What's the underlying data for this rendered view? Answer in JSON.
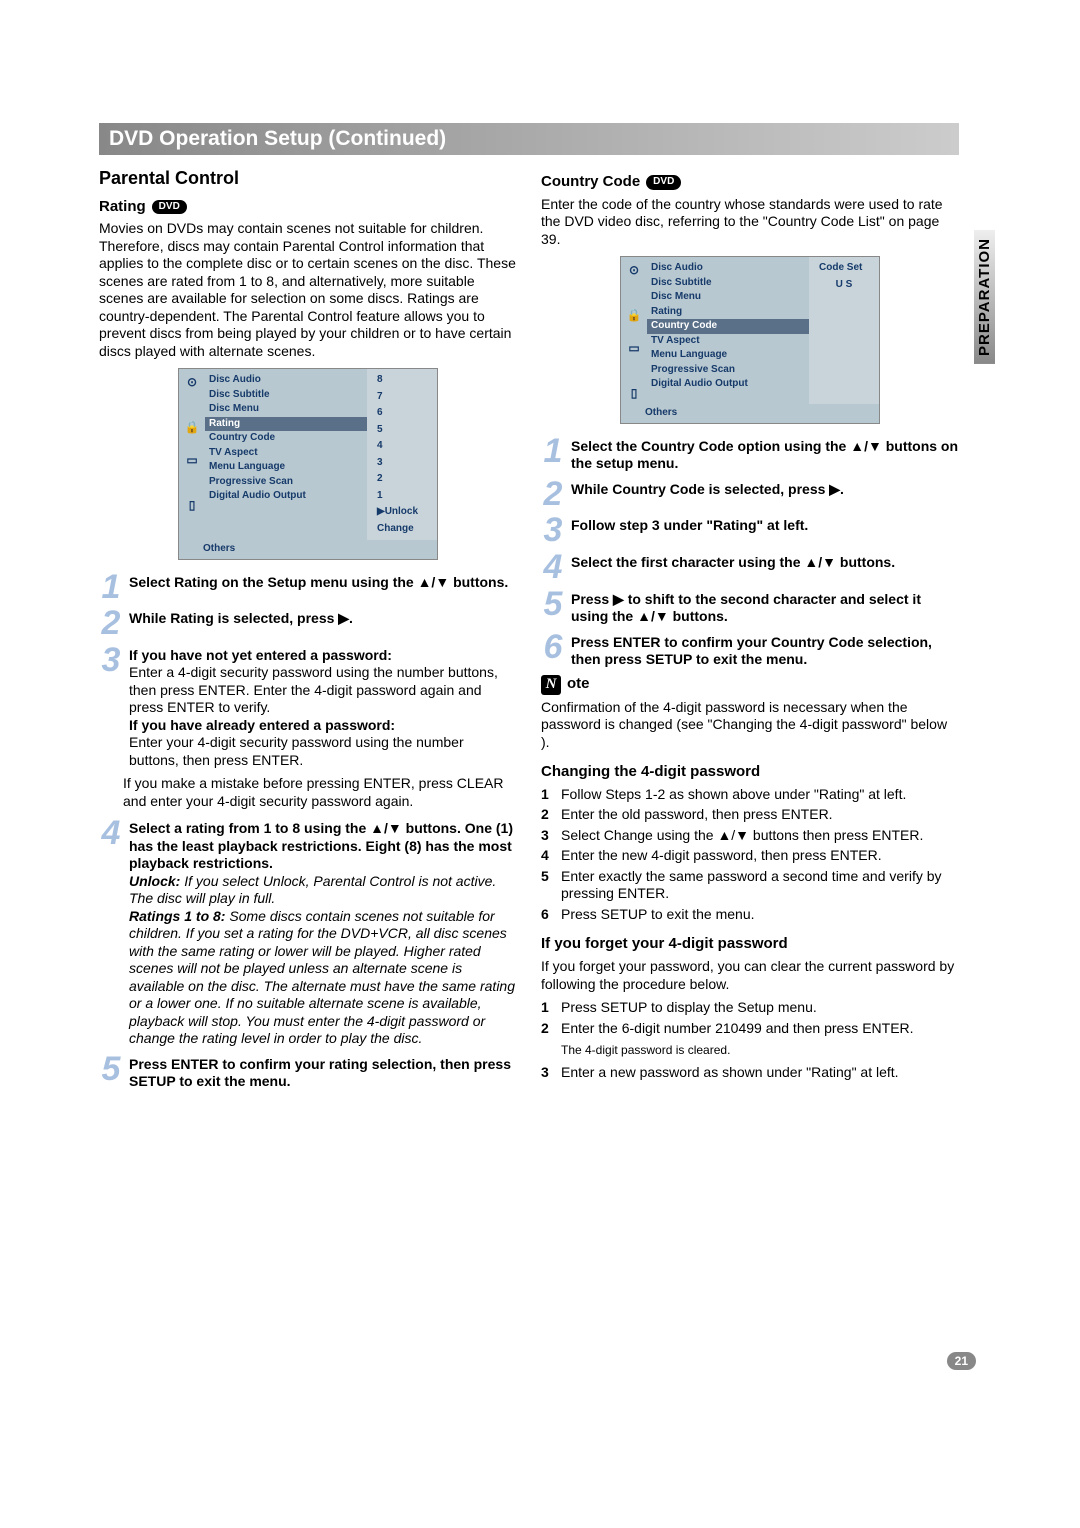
{
  "banner": "DVD Operation Setup (Continued)",
  "side_tab": "PREPARATION",
  "page_number": "21",
  "left": {
    "heading": "Parental Control",
    "rating_label": "Rating",
    "dvd_badge": "DVD",
    "rating_intro": "Movies on DVDs may contain scenes not suitable for children. Therefore, discs may contain Parental Control information that applies to the complete disc or to certain scenes on the disc. These scenes are rated from 1 to 8, and alternatively, more suitable scenes are available for selection on some discs. Ratings are country-dependent. The Parental Control feature allows you to prevent discs from being played by your children or to have certain discs played with alternate scenes.",
    "menu": {
      "items": [
        "Disc Audio",
        "Disc Subtitle",
        "Disc Menu",
        "Rating",
        "Country Code",
        "TV Aspect",
        "Menu Language",
        "Progressive Scan",
        "Digital Audio Output"
      ],
      "right": [
        "8",
        "7",
        "6",
        "5",
        "4",
        "3",
        "2",
        "1",
        "▶Unlock",
        "Change"
      ],
      "others": "Others"
    },
    "steps": [
      {
        "n": "1",
        "lead": "Select Rating on the Setup menu using the ▲/▼ buttons."
      },
      {
        "n": "2",
        "lead": "While Rating is selected, press ▶."
      },
      {
        "n": "3",
        "lead": "If you have not yet entered a password:",
        "rest": "Enter a 4-digit security password using the number buttons, then press ENTER. Enter the 4-digit password again and press ENTER to verify.",
        "lead2": "If you have already entered a password:",
        "rest2": "Enter your 4-digit security password using the number buttons, then press ENTER."
      },
      {
        "n": "4",
        "lead": "Select a rating from 1 to 8 using the ▲/▼ buttons. One (1) has the least playback restrictions. Eight (8) has the most playback restrictions.",
        "unlock_lead": "Unlock:",
        "unlock_rest": " If you select Unlock, Parental Control is not active. The disc will play in full.",
        "r18_lead": "Ratings 1 to 8:",
        "r18_rest": " Some discs contain scenes not suitable for children. If you set a rating for the DVD+VCR, all disc scenes with the same rating or lower will be played. Higher rated scenes will not be played unless an alternate scene is available on the disc. The alternate must have the same rating or a lower one. If no suitable alternate scene is available, playback will stop. You must enter the 4-digit password or change the rating level in order to play the disc."
      },
      {
        "n": "5",
        "lead": "Press ENTER to confirm your rating selection, then press SETUP to exit the menu."
      }
    ],
    "mistake_note": "If you make a mistake before pressing ENTER, press CLEAR and enter your 4-digit security password again."
  },
  "right": {
    "cc_label": "Country Code",
    "cc_intro": "Enter the code of the country whose standards were used to rate the DVD video disc, referring to the \"Country Code List\" on page 39.",
    "menu": {
      "items": [
        "Disc Audio",
        "Disc Subtitle",
        "Disc Menu",
        "Rating",
        "Country Code",
        "TV Aspect",
        "Menu Language",
        "Progressive Scan",
        "Digital Audio Output"
      ],
      "right_header": "Code Set",
      "right_value": "U  S",
      "others": "Others"
    },
    "steps": [
      {
        "n": "1",
        "lead": "Select the Country Code option using the ▲/▼ buttons on the setup menu."
      },
      {
        "n": "2",
        "lead": "While Country Code is selected, press ▶."
      },
      {
        "n": "3",
        "lead": "Follow step 3 under \"Rating\" at left."
      },
      {
        "n": "4",
        "lead": "Select the first character using the ▲/▼ buttons."
      },
      {
        "n": "5",
        "lead": "Press ▶ to shift to the second character and select it using the ▲/▼ buttons."
      },
      {
        "n": "6",
        "lead": "Press ENTER to confirm your Country Code selection, then press SETUP to exit the menu."
      }
    ],
    "note_label": "ote",
    "note_text": "Confirmation of the 4-digit password is necessary when the password is changed (see \"Changing the 4-digit password\" below ).",
    "changing_heading": "Changing the 4-digit password",
    "changing_steps": [
      "Follow Steps 1-2 as shown above under \"Rating\" at left.",
      "Enter the old password, then press ENTER.",
      "Select Change using the ▲/▼ buttons then press ENTER.",
      "Enter the new 4-digit password, then press ENTER.",
      "Enter exactly the same password a second time and verify by pressing ENTER.",
      "Press SETUP to exit the menu."
    ],
    "forget_heading": "If you forget your 4-digit password",
    "forget_intro": "If you forget your password, you can clear the current password by following the procedure below.",
    "forget_steps": [
      {
        "t": "Press SETUP to display the Setup menu."
      },
      {
        "t": "Enter the 6-digit number 210499 and then press ENTER.",
        "sub": "The 4-digit password is cleared."
      },
      {
        "t": "Enter a new password as shown under \"Rating\" at left."
      }
    ]
  }
}
